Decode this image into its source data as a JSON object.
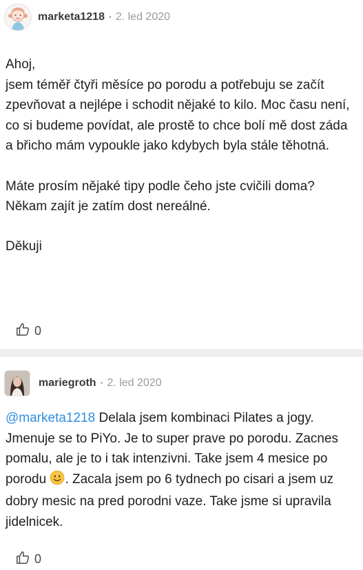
{
  "posts": [
    {
      "username": "marketa1218",
      "separator": "•",
      "date": "2. led 2020",
      "paragraphs": [
        "Ahoj,",
        "jsem téměř čtyři měsíce po porodu a potřebuju se začít zpevňovat a nejlépe i schodit nějaké to kilo. Moc času není, co si budeme povídat, ale prostě to chce bolí mě dost záda a břicho mám vypoukle jako kdybych byla stále těhotná.",
        "Máte prosím nějaké tipy podle čeho jste cvičili doma? Někam zajít je zatím dost nereálné.",
        "Děkuji"
      ],
      "likes": "0",
      "icon": "thumbs-up-icon"
    },
    {
      "username": "mariegroth",
      "separator": "•",
      "date": "2. led 2020",
      "mention": "@marketa1218",
      "text_before_emoji": " Delala jsem kombinaci Pilates a jogy. Jmenuje se to PiYo. Je to super prave po porodu. Zacnes pomalu, ale je to i tak intenzivni. Take jsem 4 mesice po porodu",
      "emoji": "slightly-smiling-face",
      "text_after_emoji": ". Zacala jsem po 6 tydnech po cisari a jsem uz dobry mesic na pred porodni vaze. Take jsme si upravila jidelnicek.",
      "likes": "0",
      "icon": "thumbs-up-icon"
    }
  ],
  "colors": {
    "mention": "#2f8fe0",
    "divider": "#f0f0f0",
    "username": "#3a3a3a",
    "date": "#9a9a9a"
  }
}
